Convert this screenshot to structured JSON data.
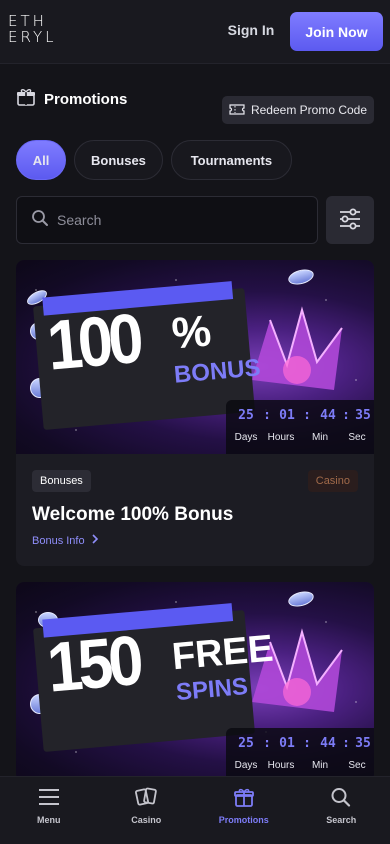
{
  "header": {
    "logo_line1": "ETH",
    "logo_line2": "ERYL",
    "signin_label": "Sign In",
    "join_label": "Join Now"
  },
  "promotions": {
    "title": "Promotions",
    "redeem_label": "Redeem Promo Code",
    "tabs": [
      {
        "label": "All",
        "active": true
      },
      {
        "label": "Bonuses",
        "active": false
      },
      {
        "label": "Tournaments",
        "active": false
      }
    ],
    "search_placeholder": "Search"
  },
  "cards": [
    {
      "big": "100",
      "side_top": "%",
      "side_bottom": "BONUS",
      "timer": {
        "days": "25",
        "hours": "01",
        "min": "44",
        "sec": "35"
      },
      "timer_labels": {
        "days": "Days",
        "hours": "Hours",
        "min": "Min",
        "sec": "Sec"
      },
      "badge": "Bonuses",
      "category": "Casino",
      "title": "Welcome 100% Bonus",
      "info": "Bonus Info"
    },
    {
      "big": "150",
      "side_top": "FREE",
      "side_bottom": "SPINS",
      "timer": {
        "days": "25",
        "hours": "01",
        "min": "44",
        "sec": "35"
      },
      "timer_labels": {
        "days": "Days",
        "hours": "Hours",
        "min": "Min",
        "sec": "Sec"
      }
    }
  ],
  "bottom_nav": [
    {
      "label": "Menu",
      "icon": "menu-icon"
    },
    {
      "label": "Casino",
      "icon": "cards-icon"
    },
    {
      "label": "Promotions",
      "icon": "gift-icon",
      "active": true
    },
    {
      "label": "Search",
      "icon": "search-icon"
    }
  ],
  "colors": {
    "accent": "#6c6af6",
    "background": "#141419",
    "card": "#1c1c23"
  }
}
